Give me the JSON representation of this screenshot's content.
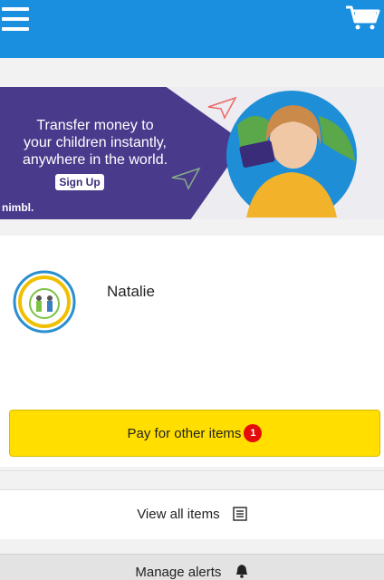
{
  "header": {
    "menu_icon": "menu-icon",
    "cart_icon": "cart-icon",
    "background": "#1a8fe0"
  },
  "banner": {
    "line1": "Transfer money to",
    "line2": "your children instantly,",
    "line3": "anywhere in the world.",
    "signup_label": "Sign Up",
    "brand": "nimbl."
  },
  "profile": {
    "child_name": "Natalie",
    "school_logo": "school-logo"
  },
  "actions": {
    "pay_label": "Pay for other items",
    "pay_badge": "1",
    "view_label": "View all items",
    "manage_label": "Manage alerts"
  },
  "colors": {
    "accent_yellow": "#ffde00",
    "badge_red": "#e40b0b",
    "banner_purple": "#4a3a8c"
  }
}
